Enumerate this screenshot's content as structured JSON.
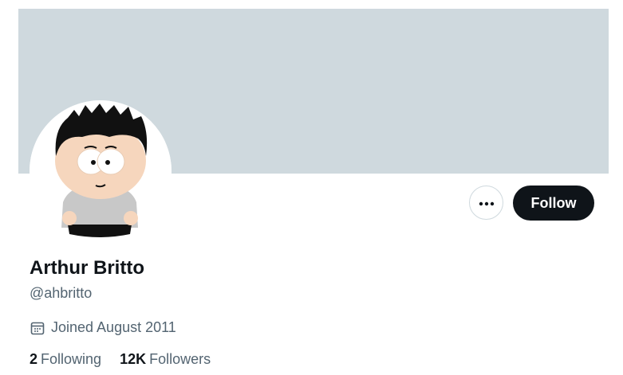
{
  "profile": {
    "display_name": "Arthur Britto",
    "handle": "@ahbritto",
    "joined": "Joined August 2011",
    "following_count": "2",
    "following_label": "Following",
    "followers_count": "12K",
    "followers_label": "Followers"
  },
  "actions": {
    "more_icon": "ellipsis-icon",
    "follow_label": "Follow"
  },
  "icons": {
    "joined_icon": "calendar-icon"
  },
  "colors": {
    "banner": "#cfd9de",
    "primary_text": "#0f1419",
    "secondary_text": "#536471",
    "follow_button_bg": "#0f1419"
  }
}
